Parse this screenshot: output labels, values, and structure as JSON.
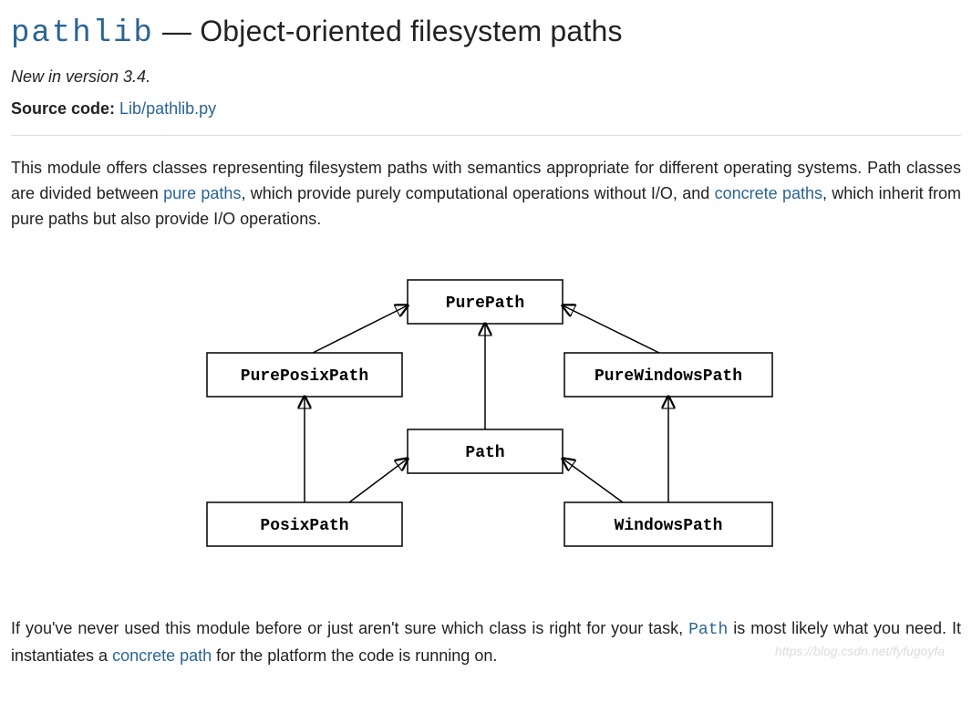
{
  "title": {
    "module": "pathlib",
    "rest": " — Object-oriented filesystem paths"
  },
  "version": "New in version 3.4.",
  "source": {
    "label": "Source code:",
    "link": "Lib/pathlib.py"
  },
  "para1": {
    "t1": "This module offers classes representing filesystem paths with semantics appropriate for different operating systems. Path classes are divided between ",
    "pure": "pure paths",
    "t2": ", which provide purely computational operations without I/O, and ",
    "concrete": "concrete paths",
    "t3": ", which inherit from pure paths but also provide I/O operations."
  },
  "diagram": {
    "purepath": "PurePath",
    "pureposix": "PurePosixPath",
    "purewindows": "PureWindowsPath",
    "path": "Path",
    "posixpath": "PosixPath",
    "windowspath": "WindowsPath"
  },
  "para2": {
    "t1": "If you've never used this module before or just aren't sure which class is right for your task, ",
    "path": "Path",
    "t2": " is most likely what you need. It instantiates a ",
    "concrete": "concrete path",
    "t3": " for the platform the code is running on."
  },
  "watermark": "https://blog.csdn.net/fyfugoyfa"
}
